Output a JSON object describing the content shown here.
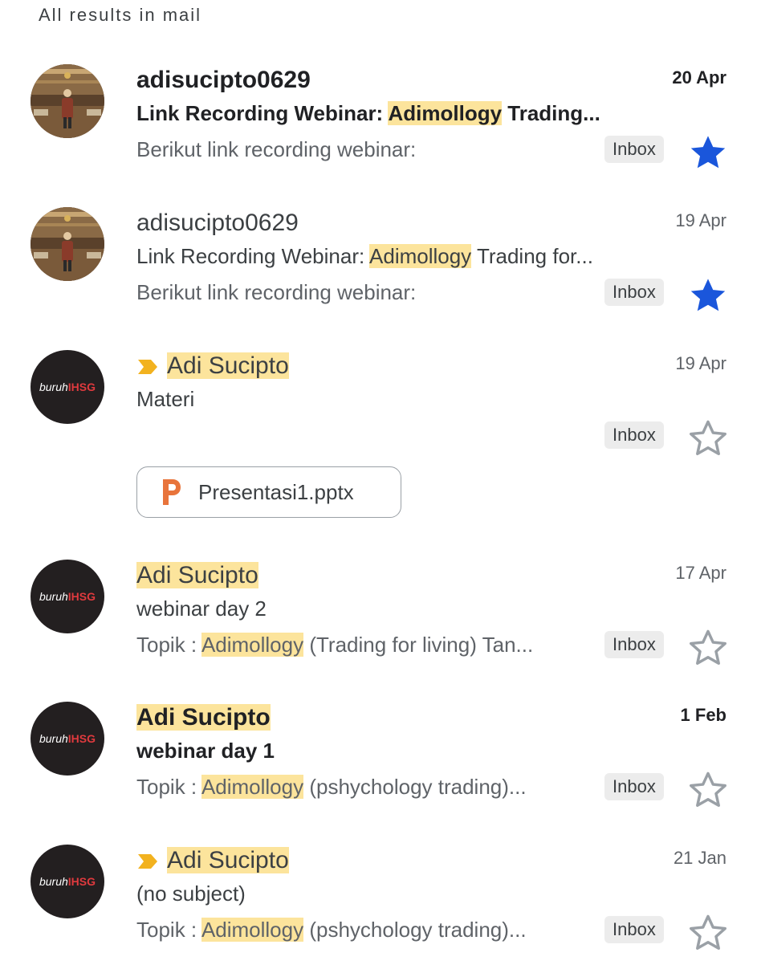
{
  "header": {
    "title": "All results in mail"
  },
  "emails": [
    {
      "sender": "adisucipto0629",
      "date": "20 Apr",
      "subject_pre": "Link Recording Webinar: ",
      "subject_hl": "Adimollogy",
      "subject_post": " Trading...",
      "snippet_pre": "Berikut link recording webinar:",
      "snippet_hl": "",
      "snippet_post": "",
      "label": "Inbox",
      "starred": true,
      "unread": true
    },
    {
      "sender": "adisucipto0629",
      "date": "19 Apr",
      "subject_pre": "Link Recording Webinar: ",
      "subject_hl": "Adimollogy",
      "subject_post": " Trading for...",
      "snippet_pre": "Berikut link recording webinar:",
      "snippet_hl": "",
      "snippet_post": "",
      "label": "Inbox",
      "starred": true,
      "unread": false
    },
    {
      "sender": "Adi Sucipto",
      "date": "19 Apr",
      "subject_pre": "Materi",
      "subject_hl": "",
      "subject_post": "",
      "label": "Inbox",
      "starred": false,
      "unread": false,
      "important": true,
      "attachment": "Presentasi1.pptx"
    },
    {
      "sender": "Adi Sucipto",
      "date": "17 Apr",
      "subject_pre": "webinar day 2",
      "subject_hl": "",
      "subject_post": "",
      "snippet_pre": "Topik : ",
      "snippet_hl": "Adimollogy",
      "snippet_post": " (Trading for living) Tan...",
      "label": "Inbox",
      "starred": false,
      "unread": false
    },
    {
      "sender": "Adi Sucipto",
      "date": "1 Feb",
      "subject_pre": "webinar day 1",
      "subject_hl": "",
      "subject_post": "",
      "snippet_pre": "Topik : ",
      "snippet_hl": "Adimollogy",
      "snippet_post": " (pshychology trading)...",
      "label": "Inbox",
      "starred": false,
      "unread": true
    },
    {
      "sender": "Adi Sucipto",
      "date": "21 Jan",
      "subject_pre": "(no subject)",
      "subject_hl": "",
      "subject_post": "",
      "snippet_pre": "Topik : ",
      "snippet_hl": "Adimollogy",
      "snippet_post": " (pshychology trading)...",
      "label": "Inbox",
      "starred": false,
      "unread": false,
      "important": true
    }
  ],
  "brand_avatar": {
    "part1": "buruh",
    "part2": "IHSG"
  },
  "colors": {
    "highlight": "#fce49c",
    "star_filled": "#1a56db",
    "star_outline": "#9aa0a6",
    "importance": "#f2b21f",
    "ppt_icon": "#e8743b"
  },
  "icons": {
    "star_filled": "star-filled-icon",
    "star_outline": "star-outline-icon",
    "importance": "importance-marker-icon",
    "attachment": "powerpoint-icon"
  }
}
